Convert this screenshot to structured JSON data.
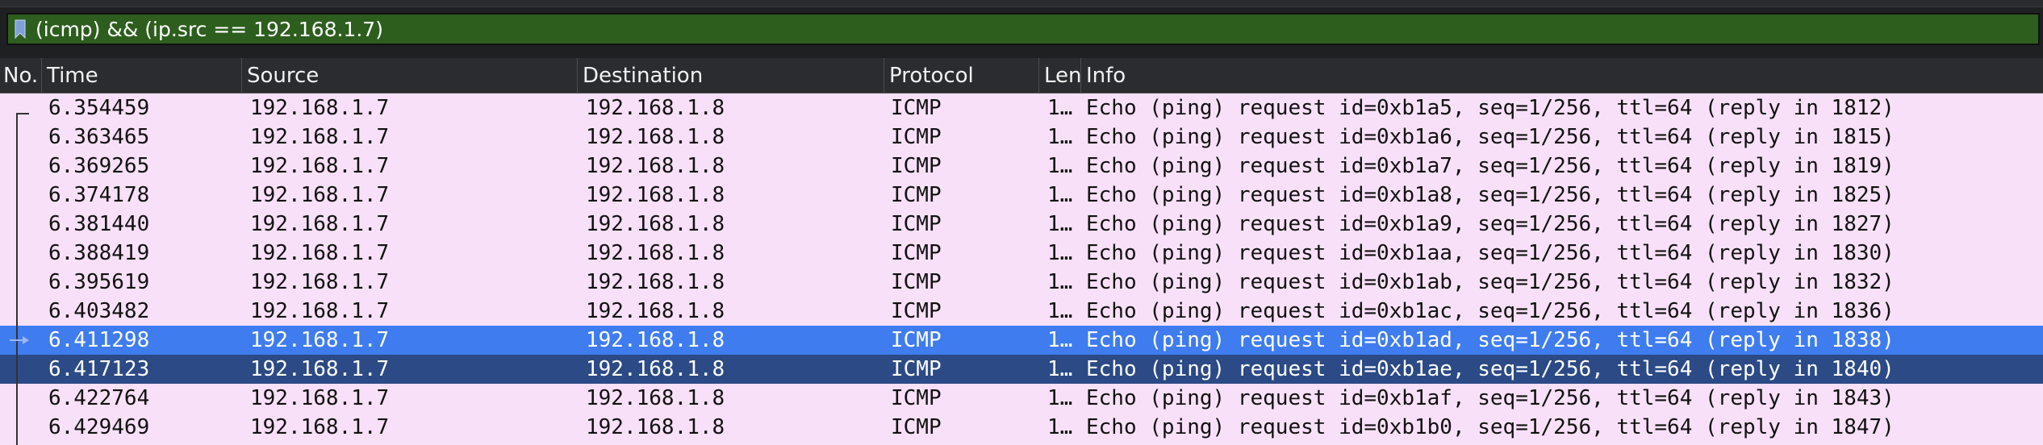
{
  "filter": {
    "value": "(icmp) && (ip.src == 192.168.1.7)",
    "bookmark_icon": "bookmark-icon"
  },
  "columns": {
    "no": "No.",
    "time": "Time",
    "source": "Source",
    "destination": "Destination",
    "protocol": "Protocol",
    "length": "Len",
    "info": "Info"
  },
  "packets": [
    {
      "time": "6.354459",
      "source": "192.168.1.7",
      "destination": "192.168.1.8",
      "protocol": "ICMP",
      "length": "1…",
      "info": "Echo (ping) request  id=0xb1a5, seq=1/256, ttl=64 (reply in 1812)"
    },
    {
      "time": "6.363465",
      "source": "192.168.1.7",
      "destination": "192.168.1.8",
      "protocol": "ICMP",
      "length": "1…",
      "info": "Echo (ping) request  id=0xb1a6, seq=1/256, ttl=64 (reply in 1815)"
    },
    {
      "time": "6.369265",
      "source": "192.168.1.7",
      "destination": "192.168.1.8",
      "protocol": "ICMP",
      "length": "1…",
      "info": "Echo (ping) request  id=0xb1a7, seq=1/256, ttl=64 (reply in 1819)"
    },
    {
      "time": "6.374178",
      "source": "192.168.1.7",
      "destination": "192.168.1.8",
      "protocol": "ICMP",
      "length": "1…",
      "info": "Echo (ping) request  id=0xb1a8, seq=1/256, ttl=64 (reply in 1825)"
    },
    {
      "time": "6.381440",
      "source": "192.168.1.7",
      "destination": "192.168.1.8",
      "protocol": "ICMP",
      "length": "1…",
      "info": "Echo (ping) request  id=0xb1a9, seq=1/256, ttl=64 (reply in 1827)"
    },
    {
      "time": "6.388419",
      "source": "192.168.1.7",
      "destination": "192.168.1.8",
      "protocol": "ICMP",
      "length": "1…",
      "info": "Echo (ping) request  id=0xb1aa, seq=1/256, ttl=64 (reply in 1830)"
    },
    {
      "time": "6.395619",
      "source": "192.168.1.7",
      "destination": "192.168.1.8",
      "protocol": "ICMP",
      "length": "1…",
      "info": "Echo (ping) request  id=0xb1ab, seq=1/256, ttl=64 (reply in 1832)"
    },
    {
      "time": "6.403482",
      "source": "192.168.1.7",
      "destination": "192.168.1.8",
      "protocol": "ICMP",
      "length": "1…",
      "info": "Echo (ping) request  id=0xb1ac, seq=1/256, ttl=64 (reply in 1836)"
    },
    {
      "time": "6.411298",
      "source": "192.168.1.7",
      "destination": "192.168.1.8",
      "protocol": "ICMP",
      "length": "1…",
      "info": "Echo (ping) request  id=0xb1ad, seq=1/256, ttl=64 (reply in 1838)"
    },
    {
      "time": "6.417123",
      "source": "192.168.1.7",
      "destination": "192.168.1.8",
      "protocol": "ICMP",
      "length": "1…",
      "info": "Echo (ping) request  id=0xb1ae, seq=1/256, ttl=64 (reply in 1840)"
    },
    {
      "time": "6.422764",
      "source": "192.168.1.7",
      "destination": "192.168.1.8",
      "protocol": "ICMP",
      "length": "1…",
      "info": "Echo (ping) request  id=0xb1af, seq=1/256, ttl=64 (reply in 1843)"
    },
    {
      "time": "6.429469",
      "source": "192.168.1.7",
      "destination": "192.168.1.8",
      "protocol": "ICMP",
      "length": "1…",
      "info": "Echo (ping) request  id=0xb1b0, seq=1/256, ttl=64 (reply in 1847)"
    }
  ],
  "colors": {
    "filter_bg": "#2d5e1d",
    "row_bg": "#f8e1f8",
    "selected_bg": "#3f7cf0",
    "selected_secondary_bg": "#2b4a86",
    "header_bg": "#2b2c30"
  }
}
